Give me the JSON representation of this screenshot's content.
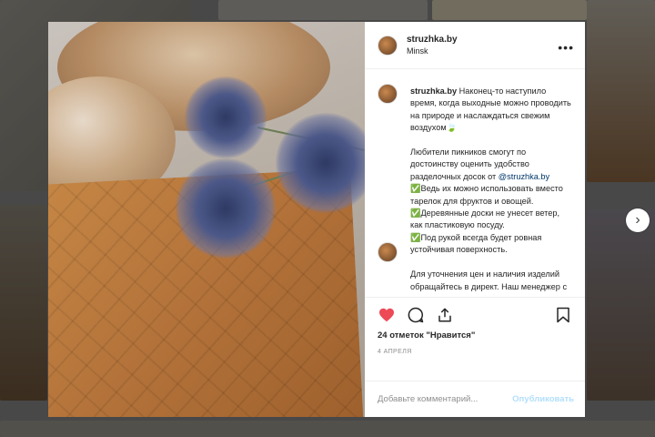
{
  "post": {
    "username": "struzhka.by",
    "location": "Minsk",
    "more_icon": "more-icon",
    "caption": {
      "username": "struzhka.by",
      "text_before_mention": " Наконец-то наступило время, когда выходные можно проводить на природе и наслаждаться свежим воздухом🍃\n\nЛюбители пикников смогут по достоинству оценить удобство разделочных досок от ",
      "mention": "@struzhka.by",
      "text_after_mention": "\n✅Ведь их можно использовать вместо тарелок для фруктов и овощей.\n✅Деревянные доски не унесет ветер, как пластиковую посуду.\n✅Под рукой всегда будет ровная устойчивая поверхность.\n\nДля уточнения цен и наличия изделий обращайтесь в директ. Наш менеджер с радостью ответит на все интересующие вопросы)"
    },
    "likes": "24 отметок \"Нравится\"",
    "date": "4 апреля",
    "icons": [
      "heart-icon",
      "comment-icon",
      "share-icon",
      "bookmark-icon"
    ],
    "like_color": "#ed4956"
  },
  "comment_box": {
    "placeholder": "Добавьте комментарий...",
    "publish_label": "Опубликовать"
  },
  "navigation": {
    "next_icon": "chevron-right-icon",
    "next_glyph": "›"
  }
}
